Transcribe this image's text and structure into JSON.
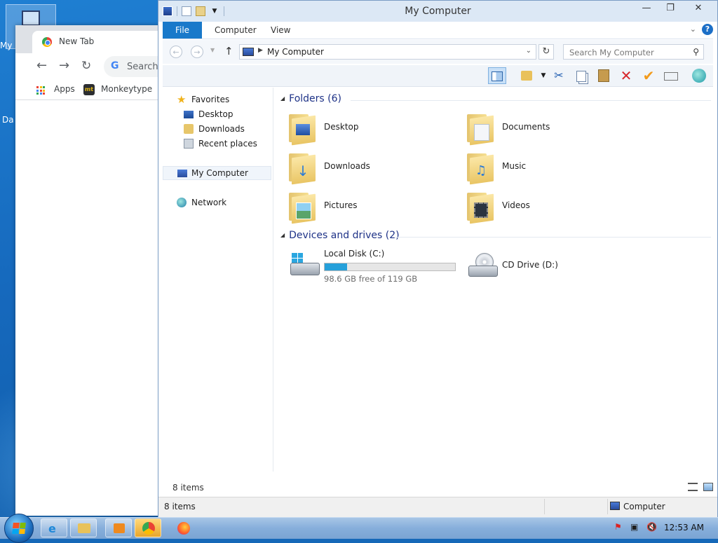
{
  "desktop": {
    "icon_label_1": "My",
    "icon_label_2": "Da"
  },
  "chrome": {
    "tab_title": "New Tab",
    "omnibox_placeholder": "Search",
    "bookmarks": [
      "Apps",
      "Monkeytype"
    ]
  },
  "explorer": {
    "title": "My Computer",
    "ribbon_tabs": [
      "File",
      "Computer",
      "View"
    ],
    "address": "My Computer",
    "search_placeholder": "Search My Computer",
    "nav": {
      "favorites": "Favorites",
      "desktop": "Desktop",
      "downloads": "Downloads",
      "recent": "Recent places",
      "computer": "My Computer",
      "network": "Network"
    },
    "folders_header": "Folders (6)",
    "folders": [
      "Desktop",
      "Documents",
      "Downloads",
      "Music",
      "Pictures",
      "Videos"
    ],
    "devices_header": "Devices and drives (2)",
    "drive_c": {
      "name": "Local Disk (C:)",
      "free_text": "98.6 GB free of 119 GB",
      "used_fraction": 0.17
    },
    "drive_d": {
      "name": "CD Drive (D:)"
    },
    "status_items": "8 items",
    "status_items_bottom": "8 items",
    "status_location": "Computer"
  },
  "taskbar": {
    "clock": "12:53 AM"
  }
}
